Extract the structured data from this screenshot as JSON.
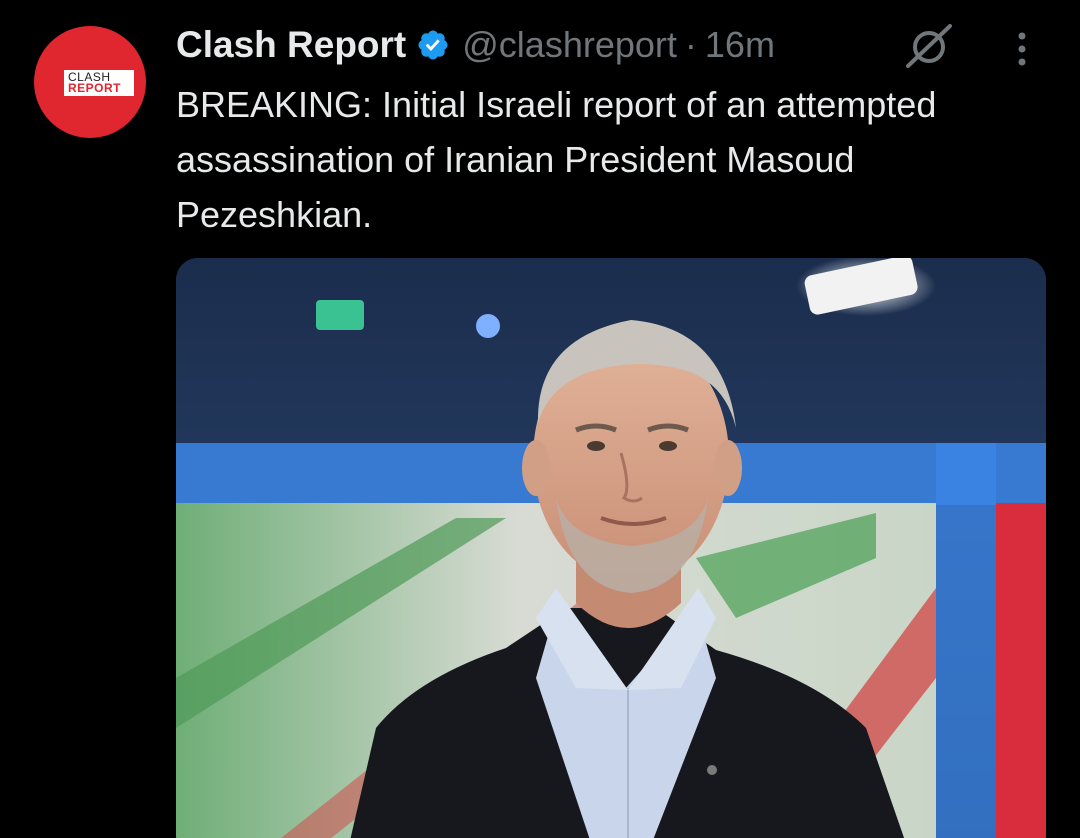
{
  "author": {
    "display_name": "Clash Report",
    "handle": "@clashreport",
    "separator": "·",
    "timestamp": "16m",
    "verified": true,
    "avatar": {
      "logo_line1": "CLASH",
      "logo_line2": "REPORT",
      "background_color": "#e0262f"
    }
  },
  "tweet": {
    "text": "BREAKING: Initial Israeli report of an attempted assassination of Iranian President Masoud Pezeshkian."
  },
  "icons": {
    "verified": "verified-badge-icon",
    "grok": "grok-icon",
    "more": "more-options-icon"
  },
  "colors": {
    "background": "#000000",
    "primary_text": "#e7e9ea",
    "secondary_text": "#71767b",
    "verified_blue": "#1d9bf0"
  }
}
